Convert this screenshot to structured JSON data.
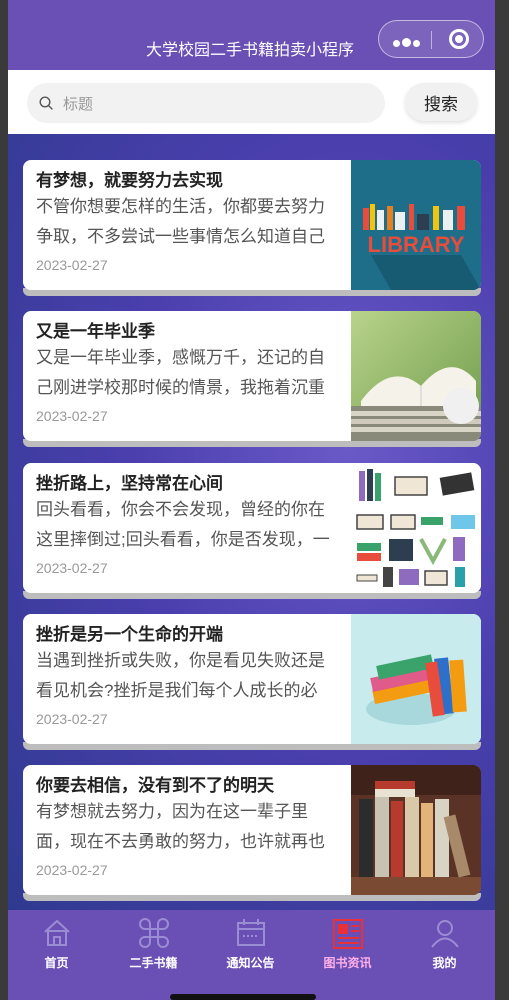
{
  "header": {
    "title": "大学校园二手书籍拍卖小程序",
    "menu_icon": "more-dots-icon",
    "close_icon": "target-circle-icon"
  },
  "search": {
    "placeholder": "标题",
    "button_label": "搜索"
  },
  "articles": [
    {
      "title": "有梦想，就要努力去实现",
      "summary": "不管你想要怎样的生活，你都要去努力争取，不多尝试一些事情怎么知道自己",
      "date": "2023-02-27",
      "image": "library-illustration"
    },
    {
      "title": "又是一年毕业季",
      "summary": "又是一年毕业季，感慨万千，还记的自己刚进学校那时候的情景，我拖着沉重",
      "date": "2023-02-27",
      "image": "open-book-photo"
    },
    {
      "title": "挫折路上，坚持常在心间",
      "summary": "回头看看，你会不会发现，曾经的你在这里摔倒过;回头看看，你是否发现，一",
      "date": "2023-02-27",
      "image": "books-icon-grid"
    },
    {
      "title": "挫折是另一个生命的开端",
      "summary": "当遇到挫折或失败，你是看见失败还是看见机会?挫折是我们每个人成长的必",
      "date": "2023-02-27",
      "image": "book-stack-illustration"
    },
    {
      "title": "你要去相信，没有到不了的明天",
      "summary": "有梦想就去努力，因为在这一辈子里面，现在不去勇敢的努力，也许就再也",
      "date": "2023-02-27",
      "image": "bookshelf-photo"
    }
  ],
  "tabbar": [
    {
      "label": "首页",
      "icon": "home-icon",
      "active": false
    },
    {
      "label": "二手书籍",
      "icon": "command-icon",
      "active": false
    },
    {
      "label": "通知公告",
      "icon": "calendar-icon",
      "active": false
    },
    {
      "label": "图书资讯",
      "icon": "newspaper-icon",
      "active": true
    },
    {
      "label": "我的",
      "icon": "user-icon",
      "active": false
    }
  ],
  "colors": {
    "header_bg": "#6a4fb4",
    "tab_active": "#ffb0e8",
    "accent_red": "#e8303a"
  }
}
